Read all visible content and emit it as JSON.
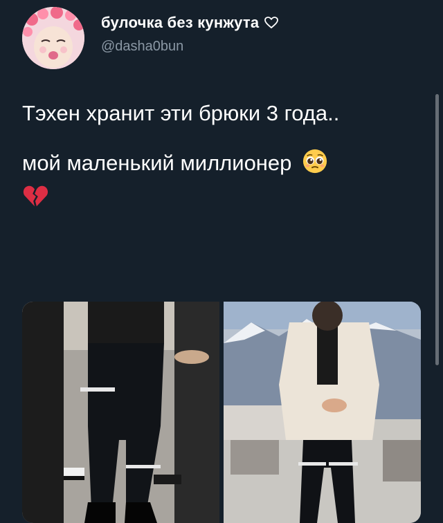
{
  "user": {
    "display_name": "булочка без кунжута",
    "handle": "@dasha0bun",
    "name_suffix_icon": "heart-outline-icon",
    "avatar_icon": "avatar-photo"
  },
  "tweet": {
    "line1": "Тэхен хранит эти брюки 3 года..",
    "line2": "мой маленький миллионер",
    "emoji_1": "pleading-face-icon",
    "emoji_2": "broken-heart-icon"
  },
  "media": {
    "count": 2,
    "items": [
      {
        "icon": "photo-person-black-ripped-jeans"
      },
      {
        "icon": "photo-person-white-jacket-mountains"
      }
    ]
  },
  "colors": {
    "background": "#15202b",
    "handle": "#8b98a5",
    "text": "#ffffff"
  }
}
